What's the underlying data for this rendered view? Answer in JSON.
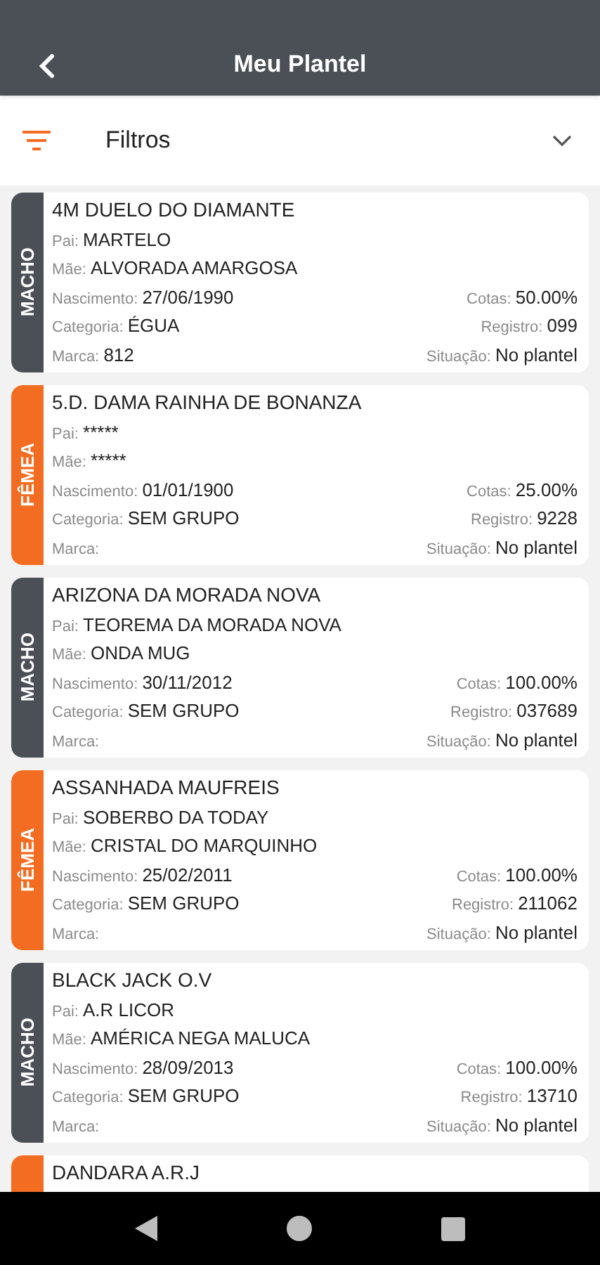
{
  "header": {
    "title": "Meu Plantel"
  },
  "filter": {
    "label": "Filtros",
    "expanded": false
  },
  "animals": [
    {
      "name": "4M DUELO DO DIAMANTE",
      "sex": "MACHO",
      "color": "#4b5056",
      "rows": [
        [
          {
            "label": "Pai:",
            "value": "MARTELO"
          }
        ],
        [
          {
            "label": "Mãe:",
            "value": "ALVORADA AMARGOSA"
          }
        ],
        [
          {
            "label": "Nascimento:",
            "value": "27/06/1990"
          },
          {
            "label": "Cotas:",
            "value": "50.00%"
          }
        ],
        [
          {
            "label": "Categoria:",
            "value": "ÉGUA"
          },
          {
            "label": "Registro:",
            "value": "099"
          }
        ],
        [
          {
            "label": "Marca:",
            "value": "812"
          },
          {
            "label": "Situação:",
            "value": "No plantel"
          }
        ]
      ]
    },
    {
      "name": "5.D. DAMA RAINHA DE BONANZA",
      "sex": "FÊMEA",
      "color": "#f26d21",
      "rows": [
        [
          {
            "label": "Pai:",
            "value": "*****"
          }
        ],
        [
          {
            "label": "Mãe:",
            "value": "*****"
          }
        ],
        [
          {
            "label": "Nascimento:",
            "value": "01/01/1900"
          },
          {
            "label": "Cotas:",
            "value": "25.00%"
          }
        ],
        [
          {
            "label": "Categoria:",
            "value": "SEM GRUPO"
          },
          {
            "label": "Registro:",
            "value": "9228"
          }
        ],
        [
          {
            "label": "Marca:"
          },
          {
            "label": "Situação:",
            "value": "No plantel"
          }
        ]
      ]
    },
    {
      "name": "ARIZONA DA MORADA NOVA",
      "sex": "MACHO",
      "color": "#4b5056",
      "rows": [
        [
          {
            "label": "Pai:",
            "value": "TEOREMA DA MORADA NOVA"
          }
        ],
        [
          {
            "label": "Mãe:",
            "value": "ONDA MUG"
          }
        ],
        [
          {
            "label": "Nascimento:",
            "value": "30/11/2012"
          },
          {
            "label": "Cotas:",
            "value": "100.00%"
          }
        ],
        [
          {
            "label": "Categoria:",
            "value": "SEM GRUPO"
          },
          {
            "label": "Registro:",
            "value": "037689"
          }
        ],
        [
          {
            "label": "Marca:"
          },
          {
            "label": "Situação:",
            "value": "No plantel"
          }
        ]
      ]
    },
    {
      "name": "ASSANHADA MAUFREIS",
      "sex": "FÊMEA",
      "color": "#f26d21",
      "rows": [
        [
          {
            "label": "Pai:",
            "value": "SOBERBO DA TODAY"
          }
        ],
        [
          {
            "label": "Mãe:",
            "value": "CRISTAL DO MARQUINHO"
          }
        ],
        [
          {
            "label": "Nascimento:",
            "value": "25/02/2011"
          },
          {
            "label": "Cotas:",
            "value": "100.00%"
          }
        ],
        [
          {
            "label": "Categoria:",
            "value": "SEM GRUPO"
          },
          {
            "label": "Registro:",
            "value": "211062"
          }
        ],
        [
          {
            "label": "Marca:"
          },
          {
            "label": "Situação:",
            "value": "No plantel"
          }
        ]
      ]
    },
    {
      "name": "BLACK JACK O.V",
      "sex": "MACHO",
      "color": "#4b5056",
      "rows": [
        [
          {
            "label": "Pai:",
            "value": "A.R LICOR"
          }
        ],
        [
          {
            "label": "Mãe:",
            "value": "AMÉRICA NEGA MALUCA"
          }
        ],
        [
          {
            "label": "Nascimento:",
            "value": "28/09/2013"
          },
          {
            "label": "Cotas:",
            "value": "100.00%"
          }
        ],
        [
          {
            "label": "Categoria:",
            "value": "SEM GRUPO"
          },
          {
            "label": "Registro:",
            "value": "13710"
          }
        ],
        [
          {
            "label": "Marca:"
          },
          {
            "label": "Situação:",
            "value": "No plantel"
          }
        ]
      ]
    },
    {
      "name": "DANDARA A.R.J",
      "color": "#f26d21"
    }
  ]
}
